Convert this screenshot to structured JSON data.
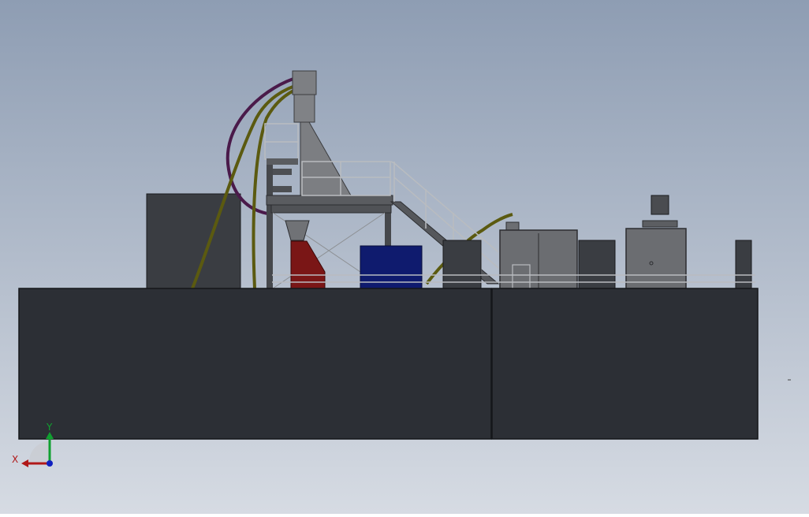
{
  "viewport": {
    "background_top": "#8e9db3",
    "background_bottom": "#d6dbe3"
  },
  "triad": {
    "x_label": "X",
    "y_label": "Y",
    "x_color": "#b01818",
    "y_color": "#10a030",
    "z_color": "#1020c0"
  },
  "colors": {
    "container": "#2c2f35",
    "container_edge": "#15171a",
    "steel": "#7d7f83",
    "steel_dark": "#4a4c50",
    "railing": "#b9bcc0",
    "hose_olive": "#5b5a10",
    "hose_purple": "#4a1a4a",
    "hopper_red": "#7a1616",
    "hopper_blue": "#0f1b6e"
  }
}
